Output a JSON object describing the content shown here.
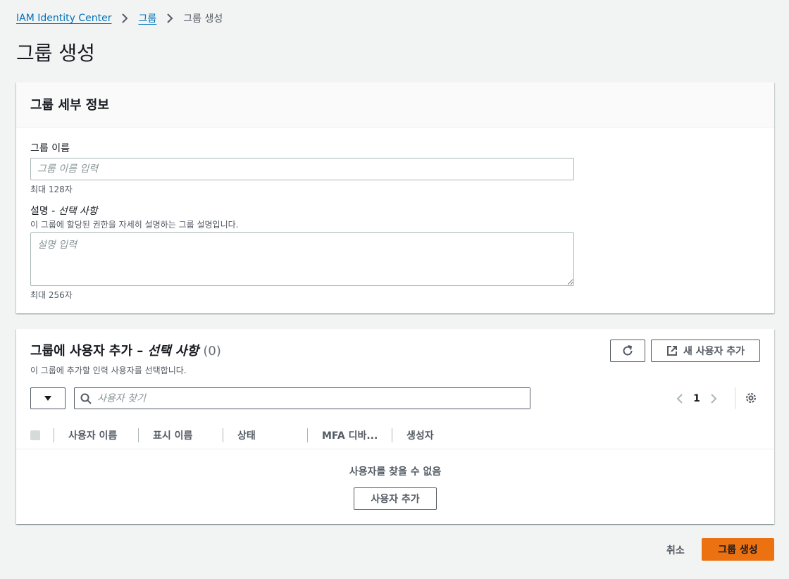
{
  "breadcrumb": {
    "items": [
      "IAM Identity Center",
      "그룹"
    ],
    "current": "그룹 생성"
  },
  "page": {
    "title": "그룹 생성"
  },
  "details_panel": {
    "title": "그룹 세부 정보",
    "group_name_label": "그룹 이름",
    "group_name_placeholder": "그룹 이름 입력",
    "group_name_value": "",
    "group_name_hint": "최대 128자",
    "description_label": "설명",
    "description_sep": " - ",
    "description_optional": "선택 사항",
    "description_help": "이 그룹에 할당된 권한을 자세히 설명하는 그룹 설명입니다.",
    "description_placeholder": "설명 입력",
    "description_value": "",
    "description_hint": "최대 256자"
  },
  "users_panel": {
    "title_main": "그룹에 사용자 추가 – ",
    "title_optional": "선택 사항",
    "title_count": "(0)",
    "description": "이 그룹에 추가할 인력 사용자를 선택합니다.",
    "refresh_icon": "refresh-icon",
    "add_new_user_label": "새 사용자 추가",
    "search_placeholder": "사용자 찾기",
    "page_number": "1",
    "columns": [
      "사용자 이름",
      "표시 이름",
      "상태",
      "MFA 디바...",
      "생성자"
    ],
    "empty_message": "사용자를 찾을 수 없음",
    "add_user_label": "사용자 추가"
  },
  "footer": {
    "cancel_label": "취소",
    "create_label": "그룹 생성"
  },
  "colors": {
    "link": "#0073bb",
    "primary": "#ec7211",
    "background": "#f2f3f3"
  }
}
